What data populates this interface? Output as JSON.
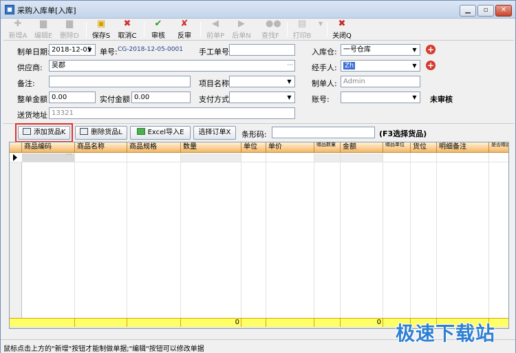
{
  "window": {
    "title": "采购入库单[入库]"
  },
  "toolbar": {
    "new": "新增A",
    "edit": "编辑E",
    "delete": "删除D",
    "save": "保存S",
    "cancel": "取消C",
    "audit": "审核",
    "unaudit": "反审",
    "prev": "前单P",
    "next": "后单N",
    "find": "查找F",
    "print": "打印B",
    "close": "关闭Q"
  },
  "form": {
    "date_label": "制单日期:",
    "date_value": "2018-12-05",
    "no_label": "单号:",
    "no_value": "CG-2018-12-05-0001",
    "manual_no_label": "手工单号:",
    "manual_no_value": "",
    "warehouse_label": "入库仓:",
    "warehouse_value": "一号仓库",
    "supplier_label": "供应商:",
    "supplier_value": "吴郡",
    "handler_label": "经手人:",
    "handler_value": "Zh",
    "remark_label": "备注:",
    "remark_value": "",
    "project_label": "项目名称:",
    "project_value": "",
    "creator_label": "制单人:",
    "creator_value": "Admin",
    "total_label": "整单金额",
    "total_value": "0.00",
    "paid_label": "实付金额",
    "paid_value": "0.00",
    "paymethod_label": "支付方式:",
    "paymethod_value": "",
    "account_label": "账号:",
    "account_value": "",
    "status_value": "未审核",
    "address_label": "送货地址",
    "address_value": "13321"
  },
  "actions": {
    "add_goods": "添加货品K",
    "remove_goods": "删除货品L",
    "excel_import": "Excel导入E",
    "select_order": "选择订单X",
    "barcode_label": "条形码:",
    "barcode_value": "",
    "barcode_hint": "(F3选择货品)"
  },
  "grid": {
    "columns": [
      "商品编码",
      "商品名称",
      "商品规格",
      "数量",
      "单位",
      "单价",
      "赠品数量",
      "金额",
      "赠品单位",
      "货位",
      "明细备注",
      "是否赠品"
    ],
    "totals": {
      "quantity": "0",
      "amount": "0"
    }
  },
  "status": {
    "text": "鼠标点击上方的\"新增\"按钮才能制做单据;\"编辑\"按钮可以修改单据"
  },
  "watermark": "极速下载站"
}
